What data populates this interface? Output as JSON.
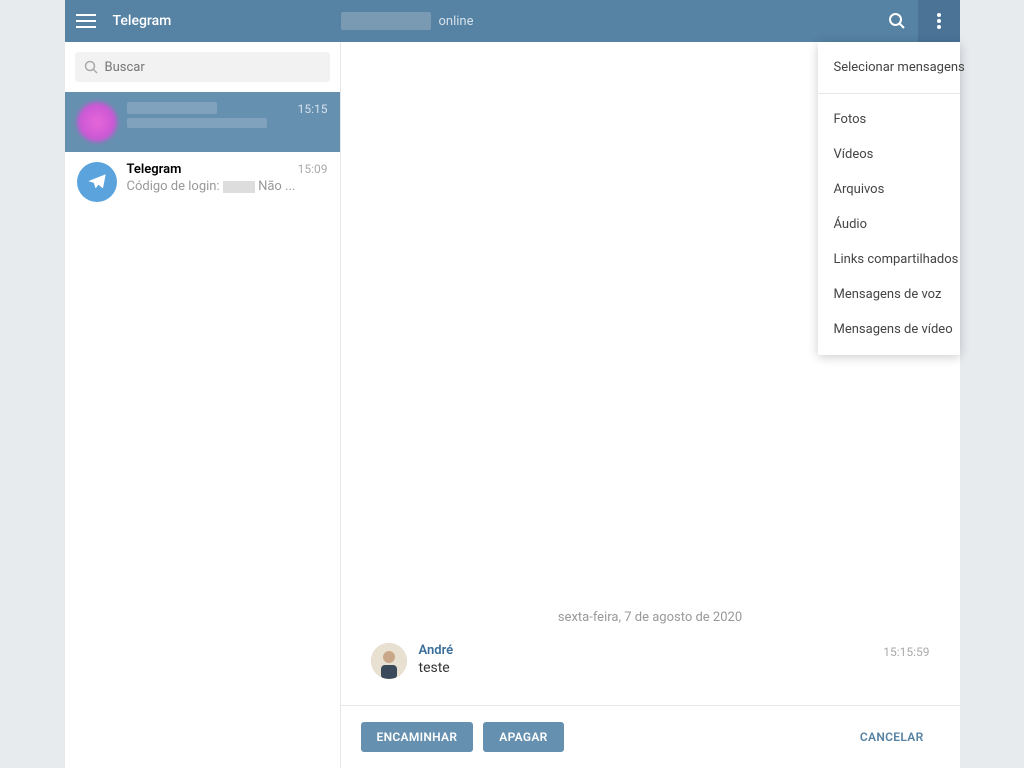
{
  "header": {
    "app_title": "Telegram",
    "status": "online"
  },
  "search": {
    "placeholder": "Buscar"
  },
  "chats": [
    {
      "time": "15:15"
    },
    {
      "name": "Telegram",
      "time": "15:09",
      "preview_prefix": "Código de login: ",
      "preview_suffix": " Não ..."
    }
  ],
  "dropdown": {
    "select_messages": "Selecionar mensagens",
    "items": [
      "Fotos",
      "Vídeos",
      "Arquivos",
      "Áudio",
      "Links compartilhados",
      "Mensagens de voz",
      "Mensagens de vídeo"
    ]
  },
  "conversation": {
    "date": "sexta-feira, 7 de agosto de 2020",
    "message": {
      "sender": "André",
      "text": "teste",
      "time": "15:15:59"
    }
  },
  "actions": {
    "forward": "ENCAMINHAR",
    "delete": "APAGAR",
    "cancel": "CANCELAR"
  }
}
